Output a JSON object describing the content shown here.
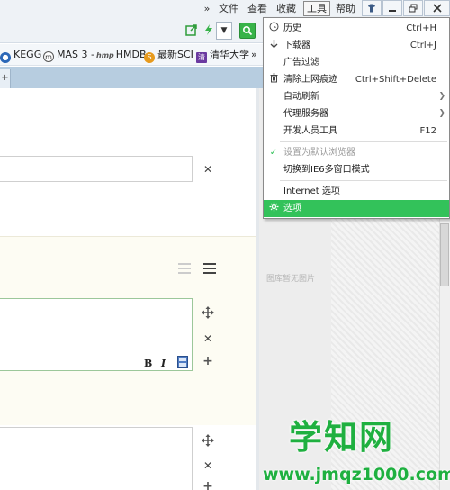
{
  "menubar": {
    "chevron": "»",
    "items": [
      "文件",
      "查看",
      "收藏",
      "工具",
      "帮助"
    ],
    "active_item": "工具"
  },
  "bookmarks": {
    "items": [
      {
        "label": "KEGG",
        "icon": "globe-icon"
      },
      {
        "label": "MAS 3 -",
        "icon": "m-icon"
      },
      {
        "label": "HMDB",
        "icon": "hmp-logo"
      },
      {
        "label": "最新SCI",
        "icon": "sci-icon"
      },
      {
        "label": "清华大学",
        "icon": "tsinghua-icon"
      }
    ],
    "more": "»"
  },
  "tools_menu": {
    "items": [
      {
        "label": "历史",
        "shortcut": "Ctrl+H",
        "icon": "clock-icon"
      },
      {
        "label": "下载器",
        "shortcut": "Ctrl+J",
        "icon": "download-icon"
      },
      {
        "label": "广告过滤",
        "shortcut": ""
      },
      {
        "label": "清除上网痕迹",
        "shortcut": "Ctrl+Shift+Delete",
        "icon": "trash-icon"
      },
      {
        "label": "自动刷新",
        "submenu": true
      },
      {
        "label": "代理服务器",
        "submenu": true
      },
      {
        "label": "开发人员工具",
        "shortcut": "F12"
      },
      {
        "label": "设置为默认浏览器",
        "disabled": true,
        "checked": true
      },
      {
        "label": "切换到IE6多窗口模式"
      },
      {
        "label": "Internet 选项"
      },
      {
        "label": "选项",
        "selected": true,
        "icon": "gear-icon"
      }
    ]
  },
  "content": {
    "format_buttons": [
      "B",
      "I"
    ],
    "no_image_text": "图库暂无图片"
  },
  "watermark": {
    "title": "学知网",
    "url": "www.jmqz1000.com"
  },
  "colors": {
    "accent": "#33c25a",
    "watermark": "#1fb040",
    "panel_bg": "#fdfcf3"
  }
}
